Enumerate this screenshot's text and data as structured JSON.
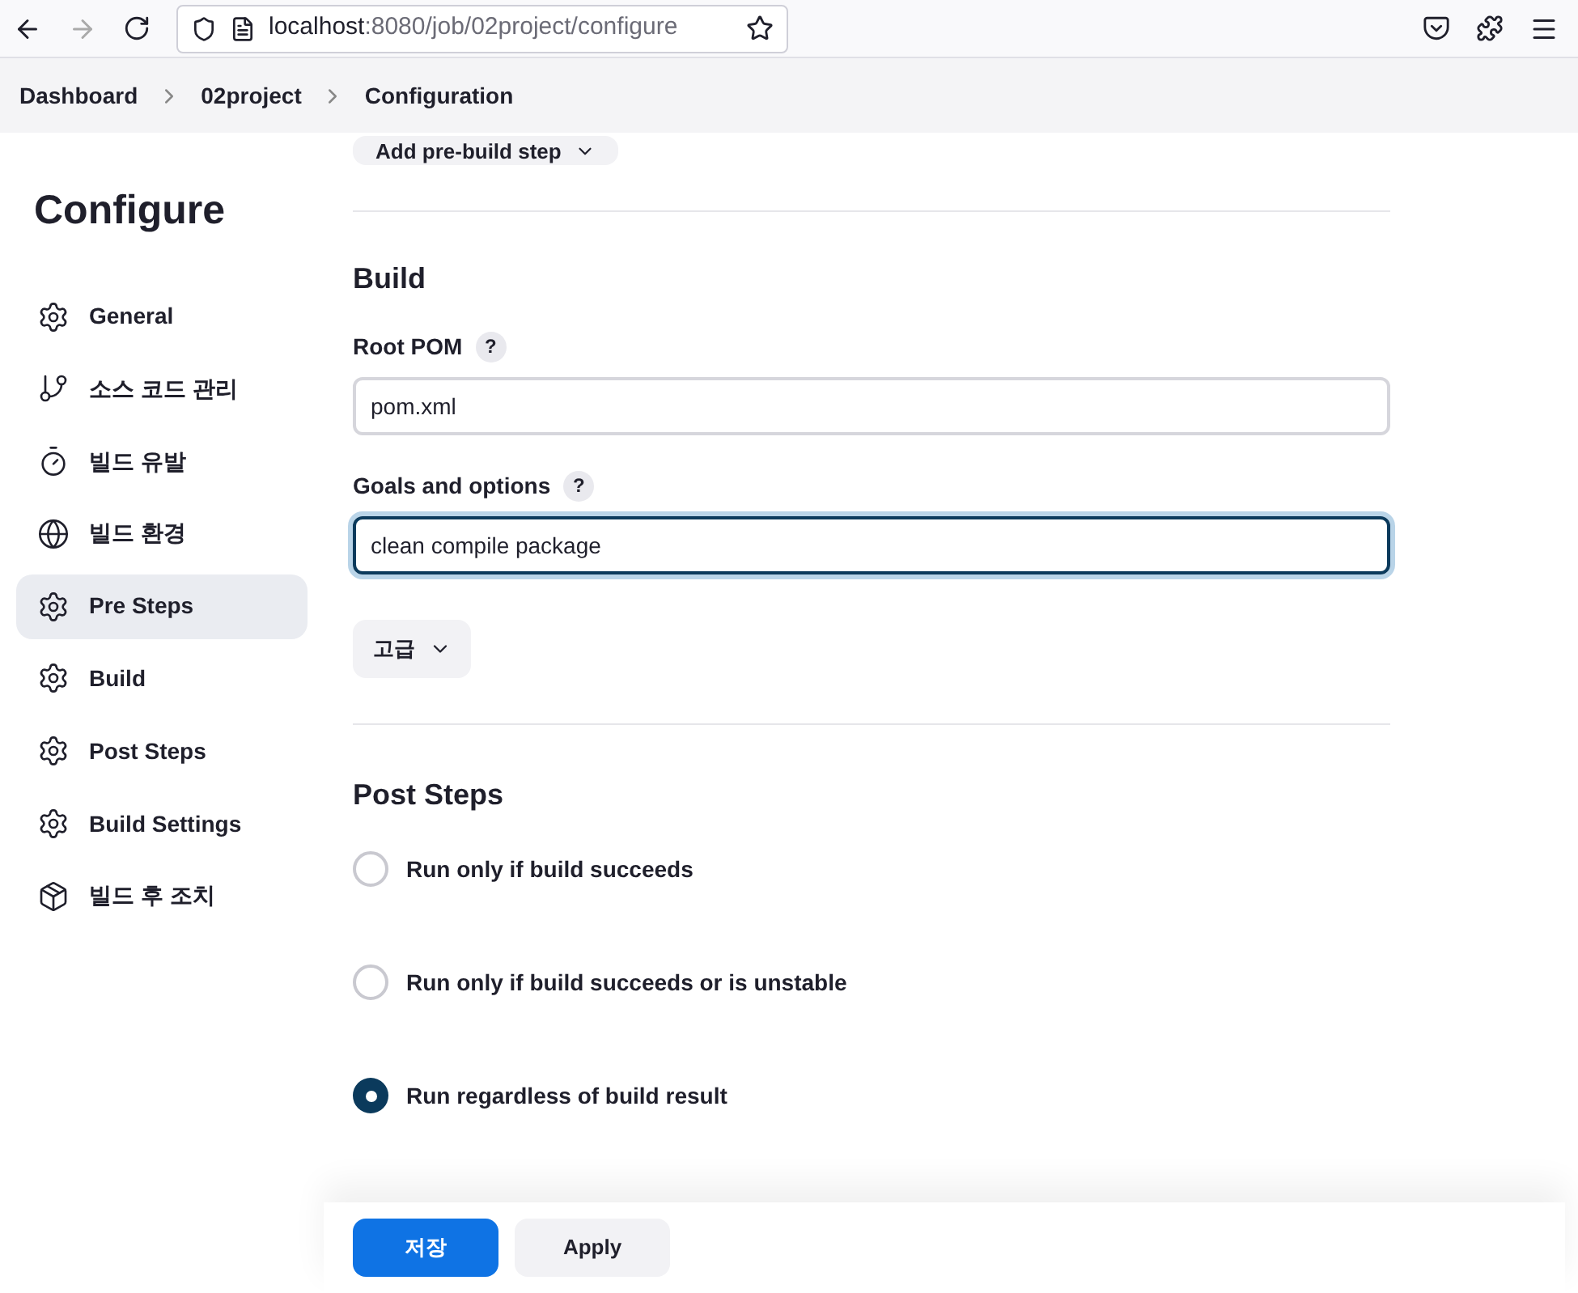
{
  "browser": {
    "url_host": "localhost",
    "url_rest": ":8080/job/02project/configure"
  },
  "breadcrumbs": [
    "Dashboard",
    "02project",
    "Configuration"
  ],
  "sidebar": {
    "title": "Configure",
    "items": [
      {
        "label": "General",
        "kind": "gear",
        "selected": false
      },
      {
        "label": "소스 코드 관리",
        "kind": "branch",
        "selected": false
      },
      {
        "label": "빌드 유발",
        "kind": "timer",
        "selected": false
      },
      {
        "label": "빌드 환경",
        "kind": "globe",
        "selected": false
      },
      {
        "label": "Pre Steps",
        "kind": "gear",
        "selected": true
      },
      {
        "label": "Build",
        "kind": "gear",
        "selected": false
      },
      {
        "label": "Post Steps",
        "kind": "gear",
        "selected": false
      },
      {
        "label": "Build Settings",
        "kind": "gear",
        "selected": false
      },
      {
        "label": "빌드 후 조치",
        "kind": "box",
        "selected": false
      }
    ]
  },
  "pre_build_button": "Add pre-build step",
  "build": {
    "heading": "Build",
    "fields": [
      {
        "label": "Root POM",
        "help": "?",
        "value": "pom.xml",
        "focused": false
      },
      {
        "label": "Goals and options",
        "help": "?",
        "value": "clean compile package",
        "focused": true
      }
    ],
    "advanced": "고급"
  },
  "post_steps": {
    "heading": "Post Steps",
    "options": [
      {
        "label": "Run only if build succeeds",
        "selected": false
      },
      {
        "label": "Run only if build succeeds or is unstable",
        "selected": false
      },
      {
        "label": "Run regardless of build result",
        "selected": true
      }
    ]
  },
  "footer": {
    "save": "저장",
    "apply": "Apply"
  }
}
